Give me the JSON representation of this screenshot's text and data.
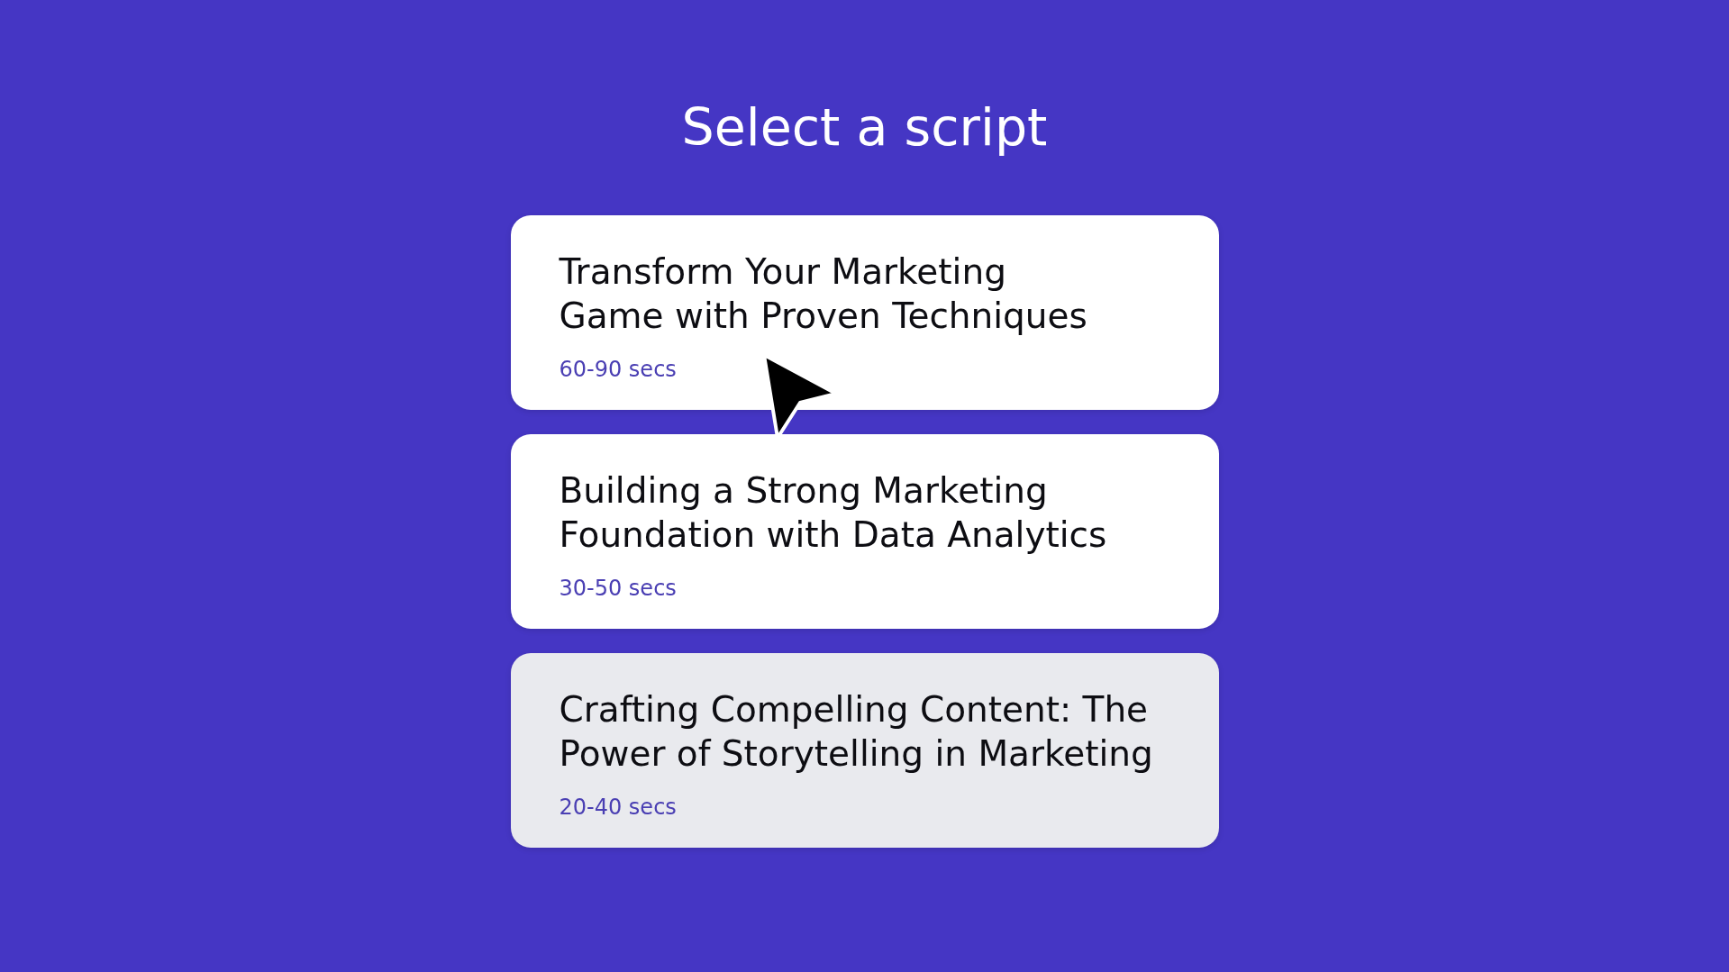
{
  "page": {
    "title": "Select a script"
  },
  "scripts": [
    {
      "title_lines": [
        "Transform Your Marketing",
        "Game with Proven Techniques"
      ],
      "duration": "60-90 secs",
      "selected": false
    },
    {
      "title_lines": [
        "Building a Strong Marketing",
        "Foundation with Data Analytics"
      ],
      "duration": "30-50 secs",
      "selected": false
    },
    {
      "title_lines": [
        "Crafting Compelling Content: The",
        "Power of Storytelling in Marketing"
      ],
      "duration": "20-40 secs",
      "selected": true
    }
  ]
}
